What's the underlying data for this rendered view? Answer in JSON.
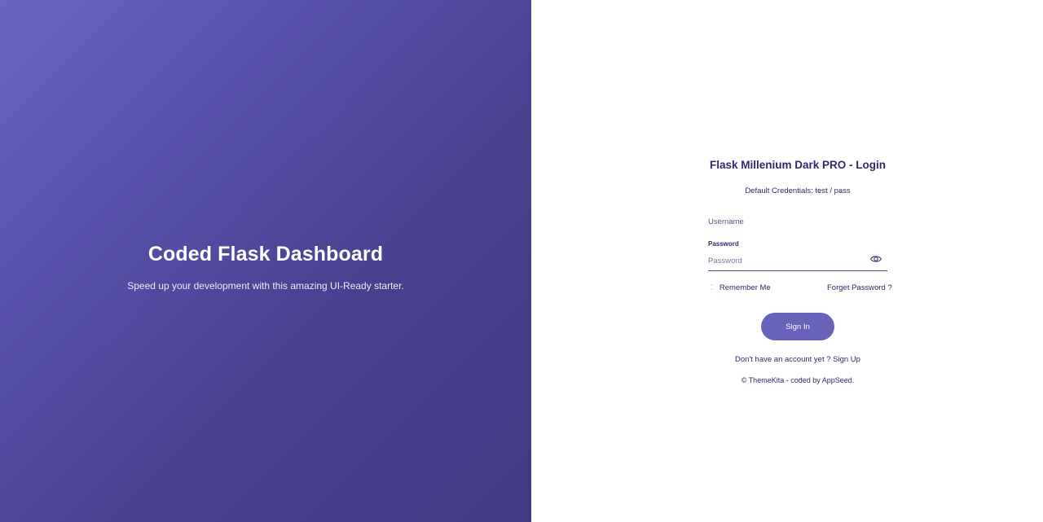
{
  "hero": {
    "title": "Coded Flask Dashboard",
    "subtitle": "Speed up your development with this amazing UI-Ready starter."
  },
  "login": {
    "title": "Flask Millenium Dark PRO - Login",
    "credentials": "Default Credentials: test / pass",
    "username_label": "Username",
    "password_label": "Password",
    "password_placeholder": "Password",
    "remember_label": "Remember Me",
    "forgot_label": "Forget Password ?",
    "signin_label": "Sign In",
    "signup_prompt": "Don't have an account yet ?",
    "signup_link": "Sign Up",
    "footer": "© ThemeKita - coded by AppSeed."
  },
  "icons": {
    "password_toggle": "eye-icon",
    "remember_check": "checkbox-icon"
  },
  "colors": {
    "brand": "#6862b8",
    "text_dark": "#2f2a6b",
    "gradient_start": "#6a66c0",
    "gradient_end": "#403a84"
  }
}
